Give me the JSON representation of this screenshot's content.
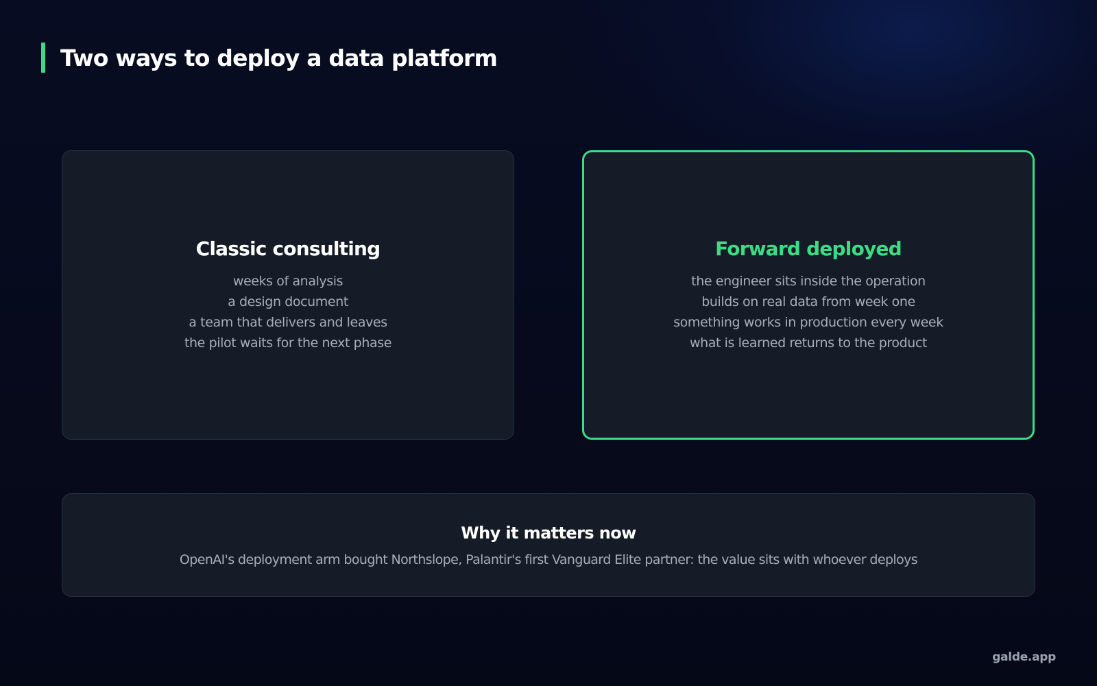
{
  "title": "Two ways to deploy a data platform",
  "colors": {
    "accent": "#3ddc84",
    "background": "#060a1b",
    "card": "#161c27",
    "muted_text": "#a7aeba"
  },
  "cards": [
    {
      "title": "Classic consulting",
      "lines": [
        "weeks of analysis",
        "a design document",
        "a team that delivers and leaves",
        "the pilot waits for the next phase"
      ]
    },
    {
      "title": "Forward deployed",
      "lines": [
        "the engineer sits inside the operation",
        "builds on real data from week one",
        "something works in production every week",
        "what is learned returns to the product"
      ]
    }
  ],
  "bottom": {
    "title": "Why it matters now",
    "text": "OpenAI's deployment arm bought Northslope, Palantir's first Vanguard Elite partner: the value sits with whoever deploys"
  },
  "brand": "galde.app"
}
